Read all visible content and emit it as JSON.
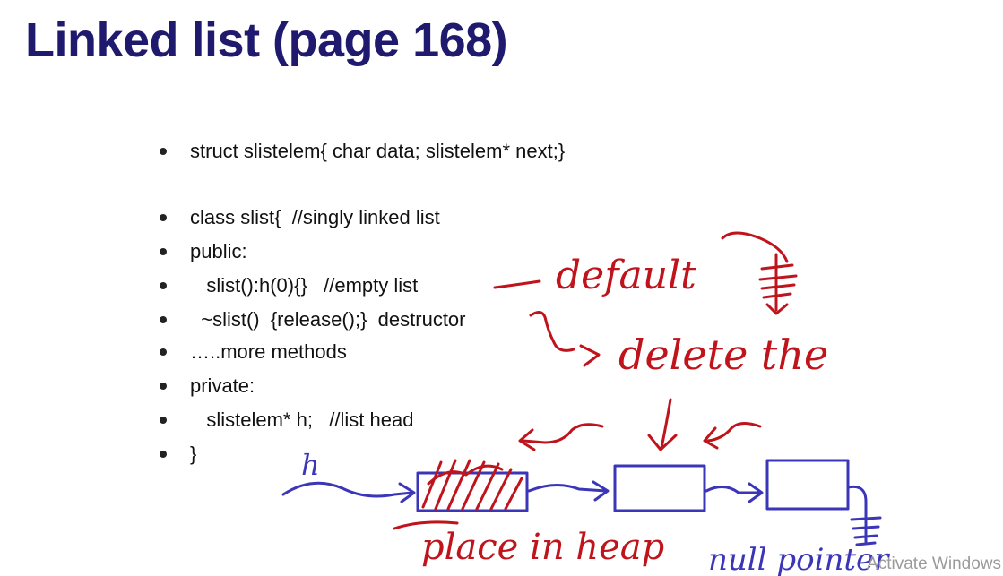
{
  "slide": {
    "title": "Linked list (page 168)",
    "bullets": [
      {
        "text": "struct slistelem{ char data; slistelem* next;}"
      },
      {
        "text": "class slist{  //singly linked list"
      },
      {
        "text": "public:"
      },
      {
        "text": "   slist():h(0){}   //empty list"
      },
      {
        "text": "  ~slist()  {release();}  destructor"
      },
      {
        "text": "…..more methods"
      },
      {
        "text": "private:"
      },
      {
        "text": "   slistelem* h;   //list head"
      },
      {
        "text": "}"
      }
    ]
  },
  "annotations": {
    "default": "default",
    "delete_the": "delete the",
    "h_label": "h",
    "place_in_heap": "place in heap",
    "null_pointer": "null pointer"
  },
  "watermark": "Activate Windows",
  "colors": {
    "title": "#1f1a6e",
    "red_ink": "#c0141c",
    "blue_ink": "#3b35b8"
  }
}
